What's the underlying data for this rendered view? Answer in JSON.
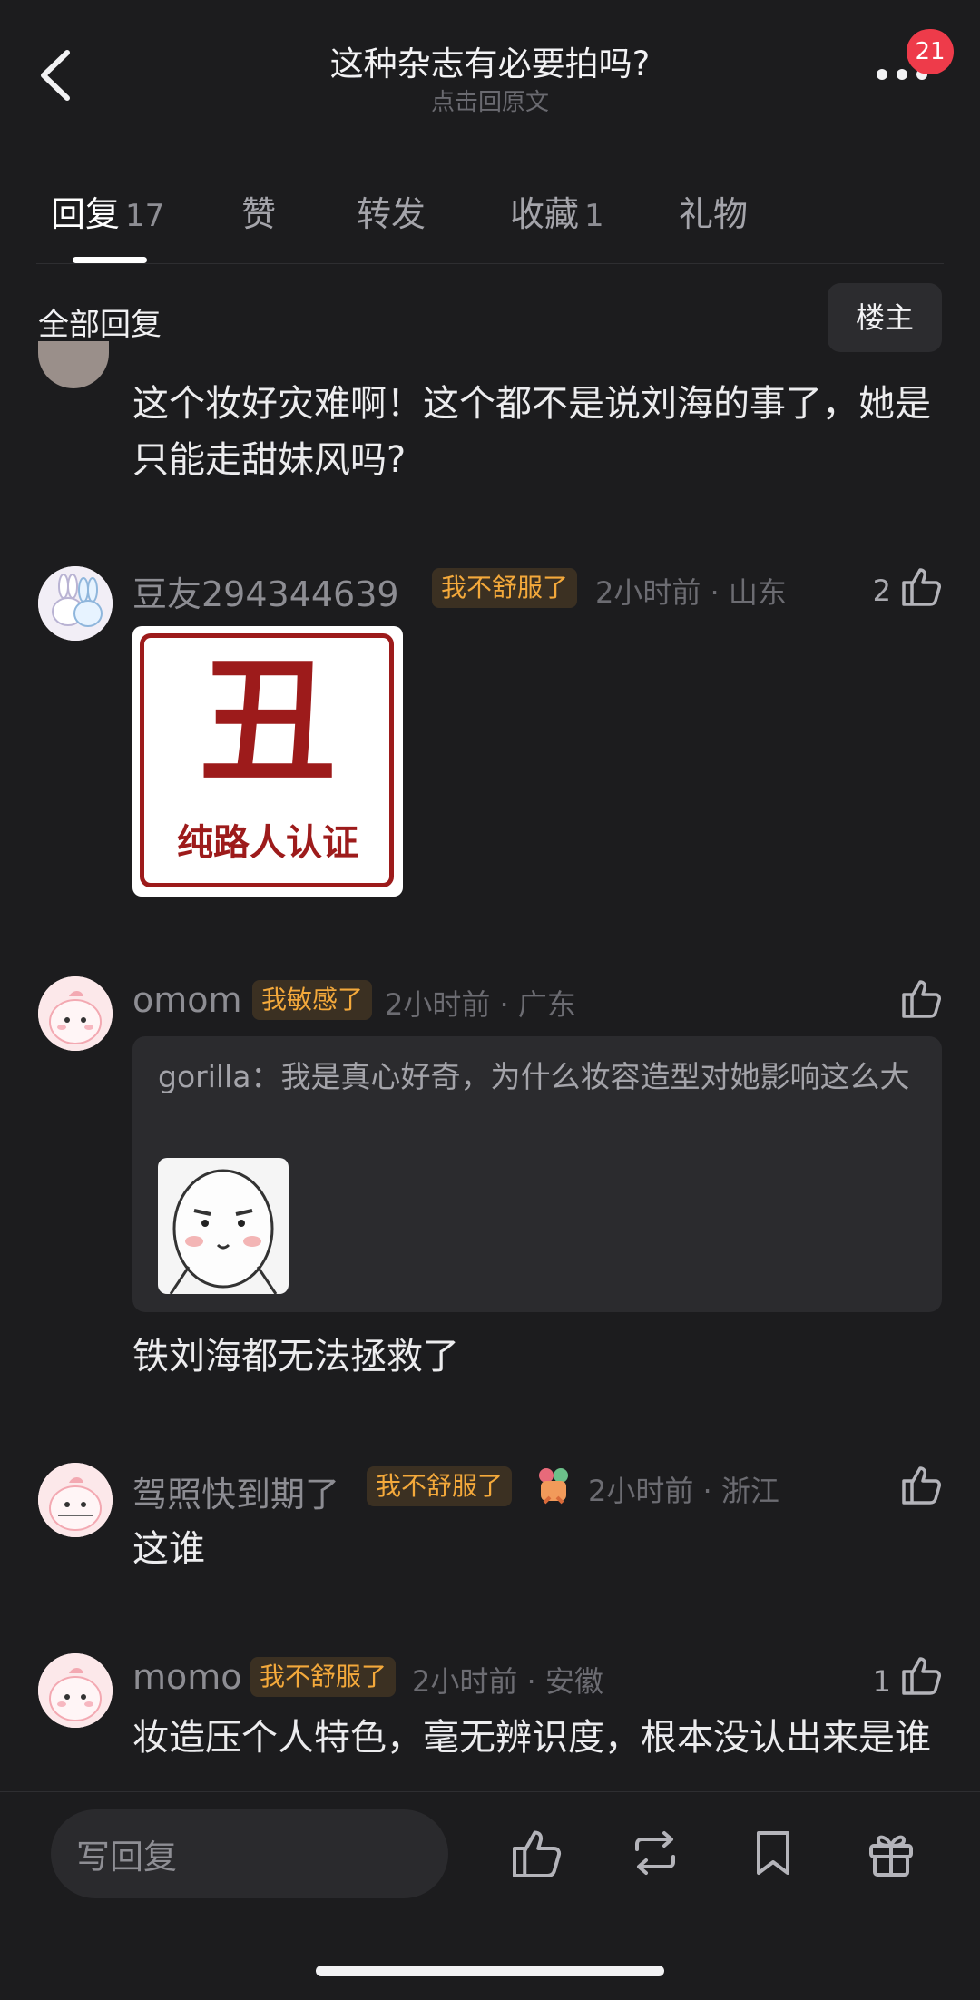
{
  "header": {
    "title": "这种杂志有必要拍吗?",
    "subtitle": "点击回原文",
    "notification_count": "21",
    "back_icon": "chevron-left-icon",
    "more_icon": "more-dots-icon"
  },
  "tabs": [
    {
      "label": "回复",
      "count": "17",
      "active": true
    },
    {
      "label": "赞",
      "count": ""
    },
    {
      "label": "转发",
      "count": ""
    },
    {
      "label": "收藏",
      "count": "1"
    },
    {
      "label": "礼物",
      "count": ""
    }
  ],
  "filter": {
    "title": "全部回复",
    "op_button": "楼主"
  },
  "comments": [
    {
      "body": "这个妆好灾难啊！这个都不是说刘海的事了，她是只能走甜妹风吗?"
    },
    {
      "username": "豆友294344639",
      "tag": "我不舒服了",
      "time": "2小时前",
      "location": "山东",
      "likes": "2",
      "sticker_text_big": "丑",
      "sticker_text_small": "纯路人认证",
      "sticker_color": "#9d1b1b"
    },
    {
      "username": "omom",
      "tag": "我敏感了",
      "time": "2小时前",
      "location": "广东",
      "likes": "",
      "quote_user": "gorilla",
      "quote_text": "我是真心好奇，为什么妆容造型对她影响这么大",
      "body": "铁刘海都无法拯救了"
    },
    {
      "username": "驾照快到期了",
      "tag": "我不舒服了",
      "time": "2小时前",
      "location": "浙江",
      "likes": "",
      "body": "这谁"
    },
    {
      "username": "momo",
      "tag": "我不舒服了",
      "time": "2小时前",
      "location": "安徽",
      "likes": "1",
      "body": "妆造压个人特色，毫无辨识度，根本没认出来是谁"
    }
  ],
  "bottom_bar": {
    "reply_placeholder": "写回复",
    "icons": [
      "thumbs-up-icon",
      "repost-icon",
      "bookmark-icon",
      "gift-icon"
    ]
  },
  "colors": {
    "background": "#1c1c1e",
    "tag_text": "#f4a93b",
    "badge": "#ee3b4a"
  }
}
